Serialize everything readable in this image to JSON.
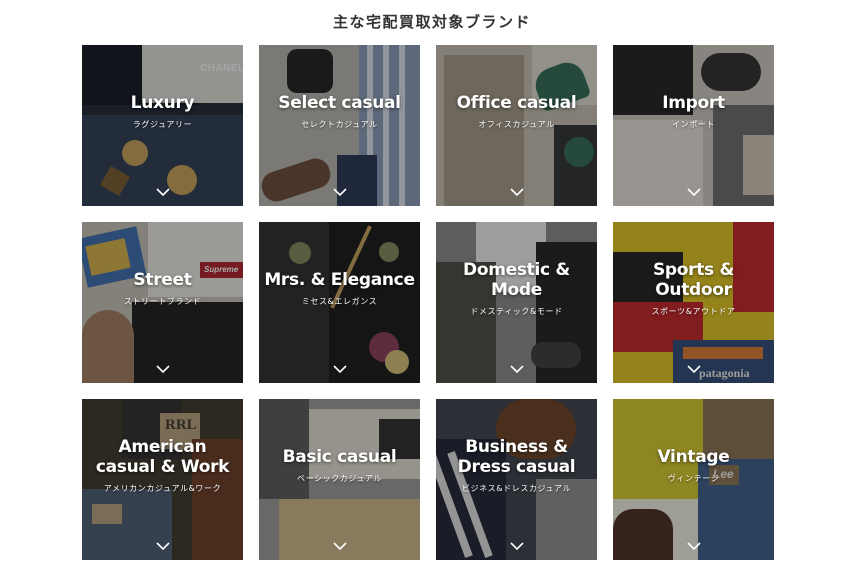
{
  "page": {
    "title": "主な宅配買取対象ブランド"
  },
  "icons": {
    "tile_arrow": "chevron-down-icon"
  },
  "tiles": [
    {
      "id": "luxury",
      "name": "Luxury",
      "sub": "ラグジュアリー",
      "photo_logo": "CHANEL",
      "colors": [
        "#1c2433",
        "#0f1420",
        "#2b3a52",
        "#7a5b2e",
        "#c9a25a"
      ]
    },
    {
      "id": "select-casual",
      "name": "Select casual",
      "sub": "セレクトカジュアル",
      "colors": [
        "#b9b6b0",
        "#8d8a85",
        "#243552",
        "#6a4a36",
        "#1d1d1d"
      ]
    },
    {
      "id": "office-casual",
      "name": "Office casual",
      "sub": "オフィスカジュアル",
      "colors": [
        "#c9c1b2",
        "#a59a86",
        "#2f6b55",
        "#2d2f33",
        "#e0dbd2"
      ]
    },
    {
      "id": "import",
      "name": "Import",
      "sub": "インポート",
      "colors": [
        "#cfcac2",
        "#1f1f1f",
        "#e8e4dc",
        "#6b6b6b",
        "#d2c9b8"
      ]
    },
    {
      "id": "street",
      "name": "Street",
      "sub": "ストリートブランド",
      "photo_logo": "Supreme",
      "colors": [
        "#c8c3b8",
        "#1a1a1a",
        "#3a6fb0",
        "#d8b24a",
        "#b3202a"
      ]
    },
    {
      "id": "mrs-elegance",
      "name": "Mrs. & Elegance",
      "sub": "ミセス&エレガンス",
      "colors": [
        "#151515",
        "#2a2a2a",
        "#7f8c5a",
        "#c7a15b",
        "#8a3b5a"
      ]
    },
    {
      "id": "domestic-mode",
      "name": "Domestic &\nMode",
      "sub": "ドメスティック&モード",
      "colors": [
        "#8a8a8a",
        "#f0f0f0",
        "#4c4a42",
        "#1f1f1f",
        "#6e6a5e"
      ]
    },
    {
      "id": "sports-outdoor",
      "name": "Sports &\nOutdoor",
      "sub": "スポーツ&アウトドア",
      "photo_logo": "patagonia",
      "colors": [
        "#e3c51e",
        "#c42126",
        "#1d1d1d",
        "#2d4a7a",
        "#f0efe9"
      ]
    },
    {
      "id": "american-casual-work",
      "name": "American\ncasual & Work",
      "sub": "アメリカンカジュアル&ワーク",
      "photo_logo": "RRL",
      "colors": [
        "#3d3428",
        "#2c2c2c",
        "#b8a27c",
        "#4a5c72",
        "#6b3a22"
      ]
    },
    {
      "id": "basic-casual",
      "name": "Basic casual",
      "sub": "ベーシックカジュアル",
      "colors": [
        "#e6e1d6",
        "#5a5a5a",
        "#cdb889",
        "#2b2b2b",
        "#9b9b98"
      ]
    },
    {
      "id": "business-dress-casual",
      "name": "Business &\nDress casual",
      "sub": "ビジネス&ドレスカジュアル",
      "colors": [
        "#3a3f4a",
        "#6b3f22",
        "#8f8f94",
        "#1d2333",
        "#e2e2e2"
      ]
    },
    {
      "id": "vintage",
      "name": "Vintage",
      "sub": "ヴィンテージ",
      "photo_logo": "Lee",
      "colors": [
        "#d9cc2a",
        "#8a7350",
        "#3b5c8a",
        "#4a2a1f",
        "#f2f0e6"
      ]
    }
  ]
}
